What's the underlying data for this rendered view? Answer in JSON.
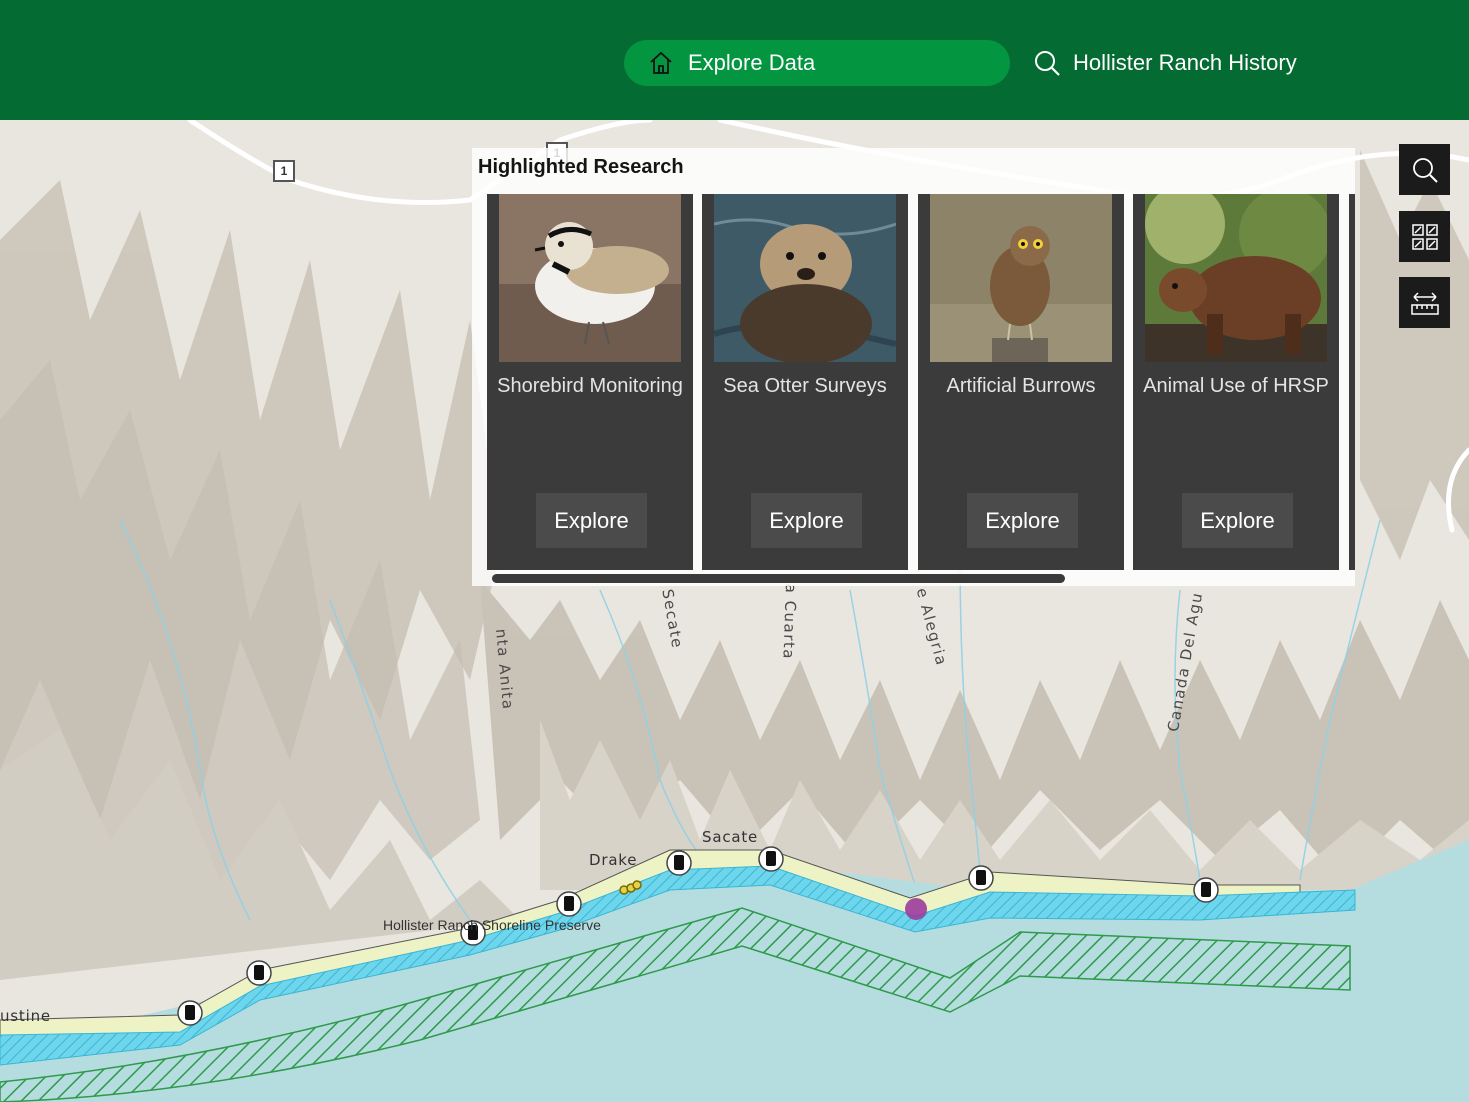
{
  "header": {
    "nav_active": {
      "label": "Explore Data",
      "icon": "home-icon"
    },
    "nav_link": {
      "label": "Hollister Ranch History",
      "icon": "search-icon"
    }
  },
  "panel": {
    "title": "Highlighted Research",
    "cards": [
      {
        "title": "Shorebird Monitoring",
        "button": "Explore",
        "image": "snowy-plover-photo"
      },
      {
        "title": "Sea Otter Surveys",
        "button": "Explore",
        "image": "sea-otter-photo"
      },
      {
        "title": "Artificial Burrows",
        "button": "Explore",
        "image": "burrowing-owl-photo"
      },
      {
        "title": "Animal Use of HRSP",
        "button": "Explore",
        "image": "bear-photo"
      }
    ]
  },
  "tools": [
    {
      "icon": "search-icon"
    },
    {
      "icon": "basemap-gallery-icon"
    },
    {
      "icon": "measure-icon"
    }
  ],
  "map": {
    "labels": {
      "canada1": "nta Anita",
      "canada2": "l Secate",
      "canada3": "a Cuarta",
      "canada4": "e Alegria",
      "canada5": "Canada Del Agu",
      "sacate": "Sacate",
      "drake": "Drake",
      "preserve": "Hollister Ranch Shoreline Preserve",
      "augustine": "ustine"
    },
    "highway_shield": "1",
    "colors": {
      "terrain": "#e9e6df",
      "ocean": "#b5dde0",
      "preserve_strip": "#6dd6ec",
      "beach": "#eef3c6",
      "protected_area": "#2e9a4a",
      "marker": "#9c3c9c"
    }
  }
}
